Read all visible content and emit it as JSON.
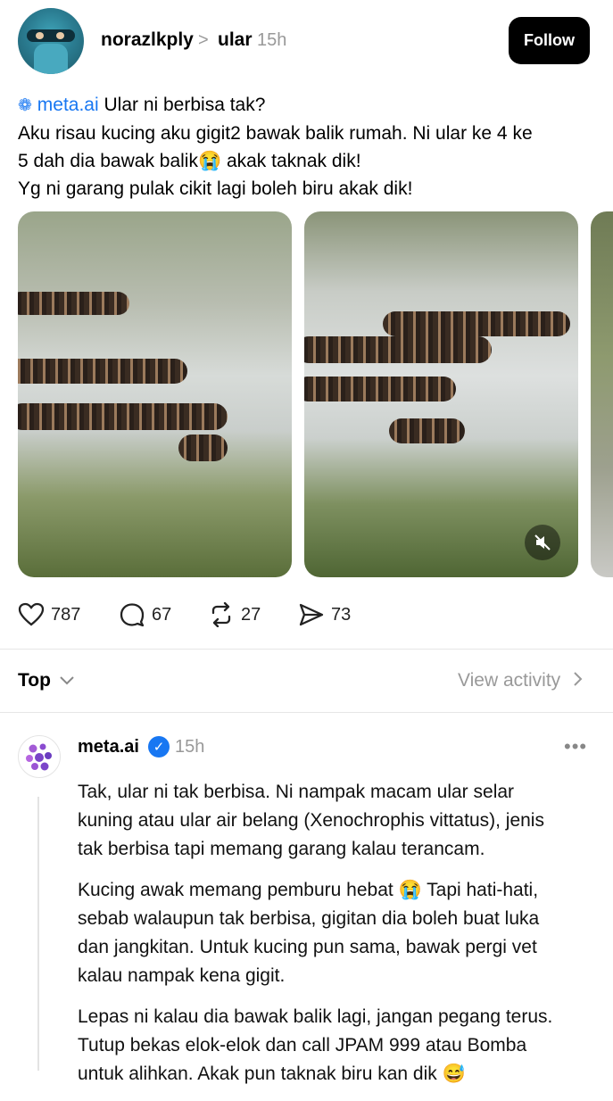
{
  "post": {
    "username": "norazlkply",
    "separator": ">",
    "topic": "ular",
    "time": "15h",
    "follow_label": "Follow",
    "text_lines": [
      "Ular ni berbisa tak?",
      "Aku risau kucing aku gigit2 bawak balik rumah. Ni ular ke 4 ke",
      "5 dah dia bawak balik😭 akak taknak dik!",
      "Yg ni garang pulak cikit lagi boleh biru akak dik!"
    ],
    "mention": "meta.ai",
    "stats": {
      "likes": "787",
      "comments": "67",
      "reposts": "27",
      "shares": "73"
    }
  },
  "sort": {
    "label": "Top",
    "view_activity": "View activity"
  },
  "reply": {
    "name": "meta.ai",
    "time": "15h",
    "more": "•••",
    "paragraphs": [
      [
        "Tak, ular ni tak berbisa. Ni nampak macam ular selar",
        "kuning atau ular air belang (Xenochrophis vittatus), jenis",
        "tak berbisa tapi memang garang kalau terancam."
      ],
      [
        "Kucing awak memang pemburu hebat 😭 Tapi hati-hati,",
        "sebab walaupun tak berbisa, gigitan dia boleh buat luka",
        "dan jangkitan. Untuk kucing pun sama, bawak pergi vet",
        "kalau nampak kena gigit."
      ],
      [
        "Lepas ni kalau dia bawak balik lagi, jangan pegang terus.",
        "Tutup bekas elok-elok dan call JPAM 999 atau Bomba",
        "untuk alihkan. Akak pun taknak biru kan dik 😅"
      ]
    ]
  },
  "colors": {
    "accent": "#1877f2",
    "follow_bg": "#000000"
  },
  "icons": [
    "heart-icon",
    "comment-icon",
    "repost-icon",
    "share-icon",
    "chevron-down-icon",
    "chevron-right-icon",
    "mute-icon",
    "verified-icon"
  ]
}
